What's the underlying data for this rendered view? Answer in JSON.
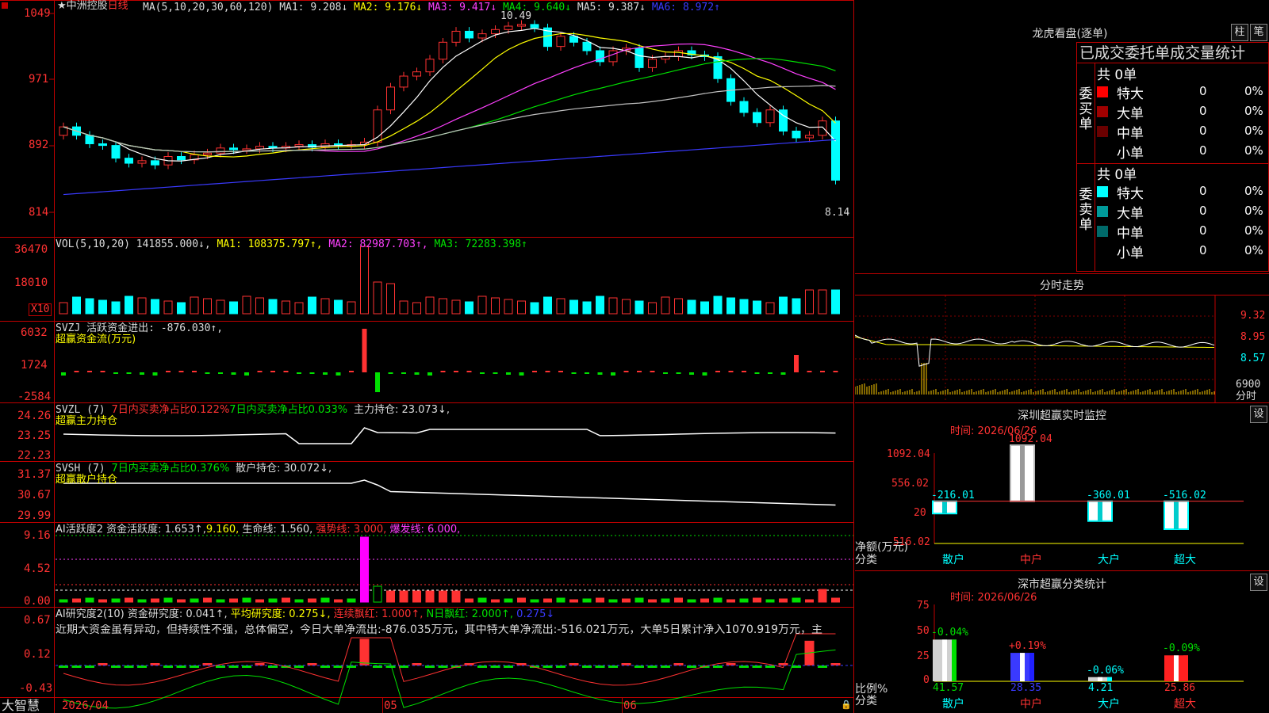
{
  "chart": {
    "stock_name": "中洲控股",
    "period": "日线",
    "ma_label": "MA(5,10,20,30,60,120)",
    "ma1": "MA1: 9.208↓",
    "ma2": "MA2: 9.176↓",
    "ma3": "MA3: 9.417↓",
    "ma4": "MA4: 9.640↓",
    "ma5": "MA5: 9.387↓",
    "ma6": "MA6: 8.972↑",
    "y_ticks": [
      "1049",
      "971",
      "892",
      "814"
    ],
    "high_label": "10.49",
    "low_label": "8.14",
    "colors": {
      "up": "#ff3232",
      "down": "#00ffff",
      "ma1": "#ffffff",
      "ma2": "#ffff00",
      "ma3": "#ff40ff",
      "ma4": "#00e000",
      "ma5": "#c0c0c0",
      "ma6": "#3a3aff"
    }
  },
  "vol": {
    "label": "VOL(5,10,20)",
    "value": "141855.000↓,",
    "ma1": "MA1: 108375.797↑,",
    "ma2": "MA2: 82987.703↑,",
    "ma3": "MA3: 72283.398↑",
    "y_ticks": [
      "36470",
      "18010"
    ],
    "unit": "X10"
  },
  "svzj": {
    "label": "SVZJ",
    "text": "活跃资金进出: -876.030↑,",
    "sub": "超赢资金流(万元)",
    "y_ticks": [
      "6032",
      "1724",
      "-2584"
    ]
  },
  "svzl": {
    "label": "SVZL (7)",
    "t1": "7日内买卖净占比0.122%",
    "t2": "7日内买卖净占比0.033%",
    "t3": "主力持仓: 23.073↓,",
    "sub": "超赢主力持仓",
    "y_ticks": [
      "24.26",
      "23.25",
      "22.23"
    ]
  },
  "svsh": {
    "label": "SVSH (7)",
    "t1": "7日内买卖净占比0.376%",
    "t2": "散户持仓: 30.072↓,",
    "sub": "超赢散户持仓",
    "y_ticks": [
      "31.37",
      "30.67",
      "29.99"
    ]
  },
  "ai1": {
    "label": "AI活跃度2",
    "t1": "资金活跃度: 1.653↑,",
    "t2": "9.160,",
    "t3": "生命线: 1.560,",
    "t4": "强势线: 3.000,",
    "t5": "爆发线: 6.000,",
    "y_ticks": [
      "9.16",
      "4.52",
      "0.00"
    ]
  },
  "ai2": {
    "label": "AI研究度2(10)",
    "t1": "资金研究度: 0.041↑,",
    "t2": "平均研究度: 0.275↓,",
    "t3": "连续飘红: 1.000↑,",
    "t4": "N日飘红: 2.000↑,",
    "t5": "0.275↓",
    "commentary": "近期大资金虽有异动，但持续性不强，总体偏空，今日大单净流出:-876.035万元，其中特大单净流出:-516.021万元，大单5日累计净入1070.919万元，主",
    "y_ticks": [
      "0.67",
      "0.12",
      "-0.43"
    ]
  },
  "xaxis": {
    "brand": "大智慧",
    "date": "2026/04",
    "m1": "05",
    "m2": "06"
  },
  "right": {
    "lhb_title": "龙虎看盘(逐单)",
    "btn_zhu": "柱",
    "btn_bi": "笔",
    "stats_title": "已成交委托单成交量统计",
    "buy_label": "委买单",
    "sell_label": "委卖单",
    "buy_total": "共 0单",
    "sell_total": "共 0单",
    "buy_rows": [
      {
        "name": "特大",
        "count": "0",
        "pct": "0%",
        "color": "#ff0000"
      },
      {
        "name": "大单",
        "count": "0",
        "pct": "0%",
        "color": "#a00000"
      },
      {
        "name": "中单",
        "count": "0",
        "pct": "0%",
        "color": "#6a0000"
      },
      {
        "name": "小单",
        "count": "0",
        "pct": "0%",
        "color": "#000000"
      }
    ],
    "sell_rows": [
      {
        "name": "特大",
        "count": "0",
        "pct": "0%",
        "color": "#00ffff"
      },
      {
        "name": "大单",
        "count": "0",
        "pct": "0%",
        "color": "#009a9a"
      },
      {
        "name": "中单",
        "count": "0",
        "pct": "0%",
        "color": "#006a6a"
      },
      {
        "name": "小单",
        "count": "0",
        "pct": "0%",
        "color": "#000000"
      }
    ],
    "intraday_title": "分时走势",
    "intraday_ticks": [
      "9.32",
      "8.95",
      "8.57",
      "6900",
      "分时"
    ],
    "sz_monitor_title": "深圳超赢实时监控",
    "sz_monitor_time": "时间: 2026/06/26",
    "sz_monitor_y": [
      "1092.04",
      "556.02",
      "20",
      "-516.02"
    ],
    "sz_monitor_ylabel": "净额(万元)",
    "sz_monitor_xlabel": "分类",
    "sz_monitor_bars": [
      {
        "name": "散户",
        "value": -216.01,
        "label": "-216.01"
      },
      {
        "name": "中户",
        "value": 1092.04,
        "label": "1092.04"
      },
      {
        "name": "大户",
        "value": -360.01,
        "label": "-360.01"
      },
      {
        "name": "超大",
        "value": -516.02,
        "label": "-516.02"
      }
    ],
    "sz_class_title": "深市超赢分类统计",
    "sz_class_time": "时间: 2026/06/26",
    "sz_class_y": [
      "75",
      "50",
      "25",
      "0"
    ],
    "sz_class_ylabel": "比例%",
    "sz_class_xlabel": "分类",
    "sz_class_bars": [
      {
        "name": "散户",
        "value": 41.57,
        "label": "41.57",
        "delta": "-0.04%"
      },
      {
        "name": "中户",
        "value": 28.35,
        "label": "28.35",
        "delta": "+0.19%"
      },
      {
        "name": "大户",
        "value": 4.21,
        "label": "4.21",
        "delta": "-0.06%"
      },
      {
        "name": "超大",
        "value": 25.86,
        "label": "25.86",
        "delta": "-0.09%"
      }
    ],
    "settings_btn": "设"
  }
}
